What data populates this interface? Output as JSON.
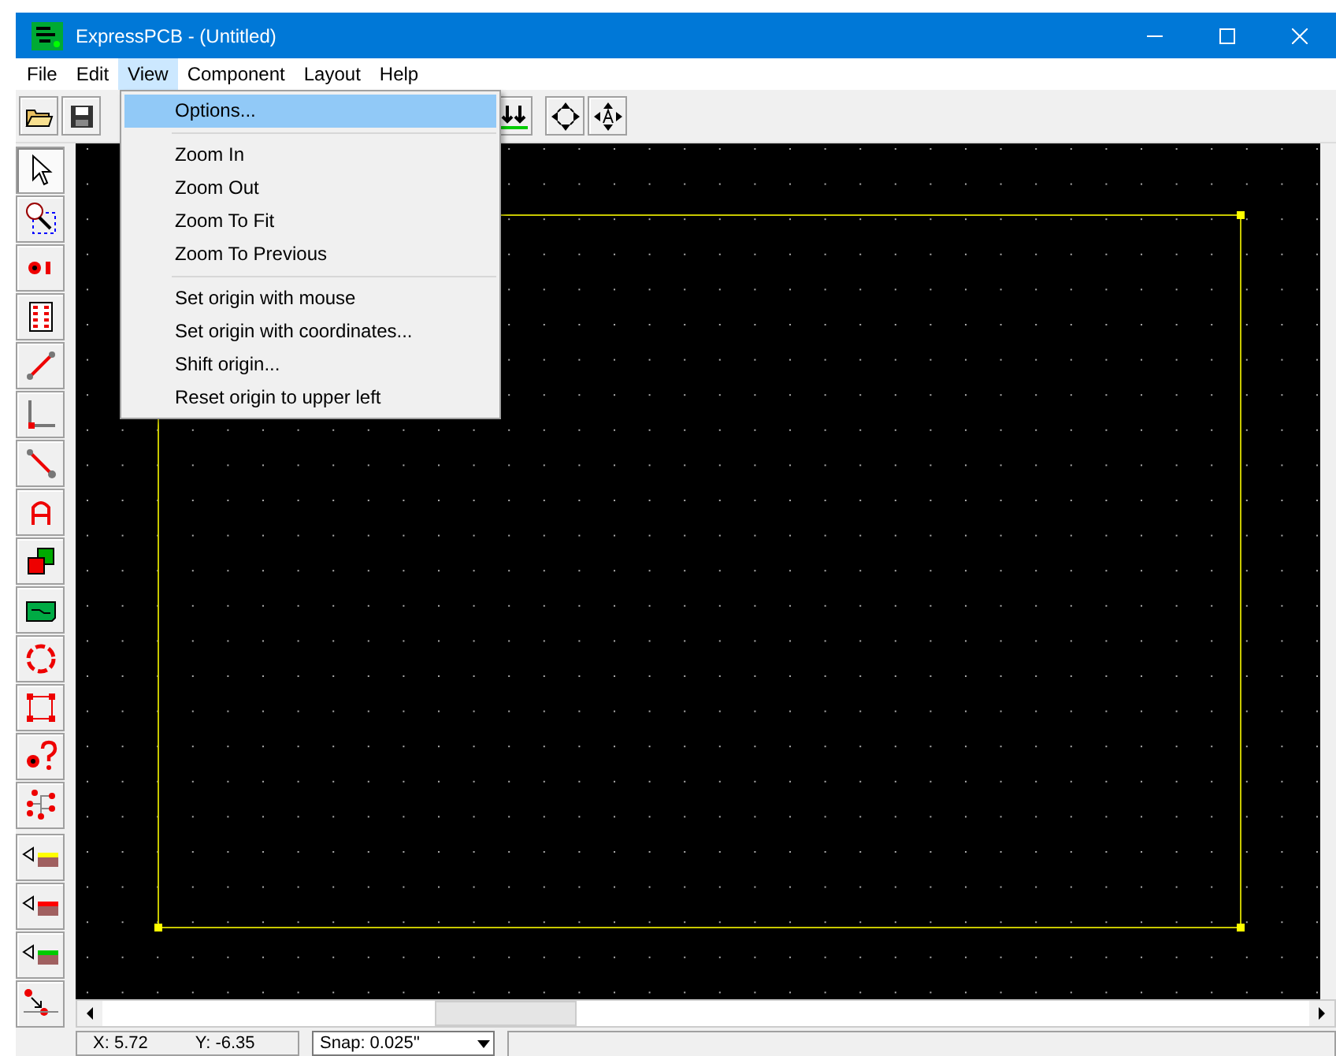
{
  "window": {
    "title": "ExpressPCB - (Untitled)"
  },
  "menu": [
    {
      "label": "File",
      "selected": false
    },
    {
      "label": "Edit",
      "selected": false
    },
    {
      "label": "View",
      "selected": true
    },
    {
      "label": "Component",
      "selected": false
    },
    {
      "label": "Layout",
      "selected": false
    },
    {
      "label": "Help",
      "selected": false
    }
  ],
  "dropdown": [
    {
      "kind": "item",
      "label": "Options...",
      "selected": true
    },
    {
      "kind": "separator"
    },
    {
      "kind": "item",
      "label": "Zoom In",
      "selected": false
    },
    {
      "kind": "item",
      "label": "Zoom Out",
      "selected": false
    },
    {
      "kind": "item",
      "label": "Zoom To Fit",
      "selected": false
    },
    {
      "kind": "item",
      "label": "Zoom To Previous",
      "selected": false
    },
    {
      "kind": "separator"
    },
    {
      "kind": "item",
      "label": "Set origin with mouse",
      "selected": false
    },
    {
      "kind": "item",
      "label": "Set origin with coordinates...",
      "selected": false
    },
    {
      "kind": "item",
      "label": "Shift origin...",
      "selected": false
    },
    {
      "kind": "item",
      "label": "Reset origin to upper left",
      "selected": false
    }
  ],
  "tools": [
    {
      "kind": "pointer",
      "selected": true
    },
    {
      "kind": "zoom",
      "selected": false
    },
    {
      "kind": "pad",
      "selected": false
    },
    {
      "kind": "component",
      "selected": false
    },
    {
      "kind": "trace",
      "selected": false
    },
    {
      "kind": "corner",
      "selected": false
    },
    {
      "kind": "line",
      "selected": false
    },
    {
      "kind": "text",
      "selected": false
    },
    {
      "kind": "layers",
      "selected": false
    },
    {
      "kind": "board",
      "selected": false
    },
    {
      "kind": "circle",
      "selected": false
    },
    {
      "kind": "rectangle",
      "selected": false
    },
    {
      "kind": "query",
      "selected": false
    },
    {
      "kind": "net",
      "selected": false
    }
  ],
  "layer_tools": [
    {
      "color": "#ffff00"
    },
    {
      "color": "#ff0000"
    },
    {
      "color": "#00cc00"
    }
  ],
  "status_bar": {
    "x": "X: 5.72",
    "y": "Y: -6.35",
    "snap": "Snap: 0.025''"
  }
}
